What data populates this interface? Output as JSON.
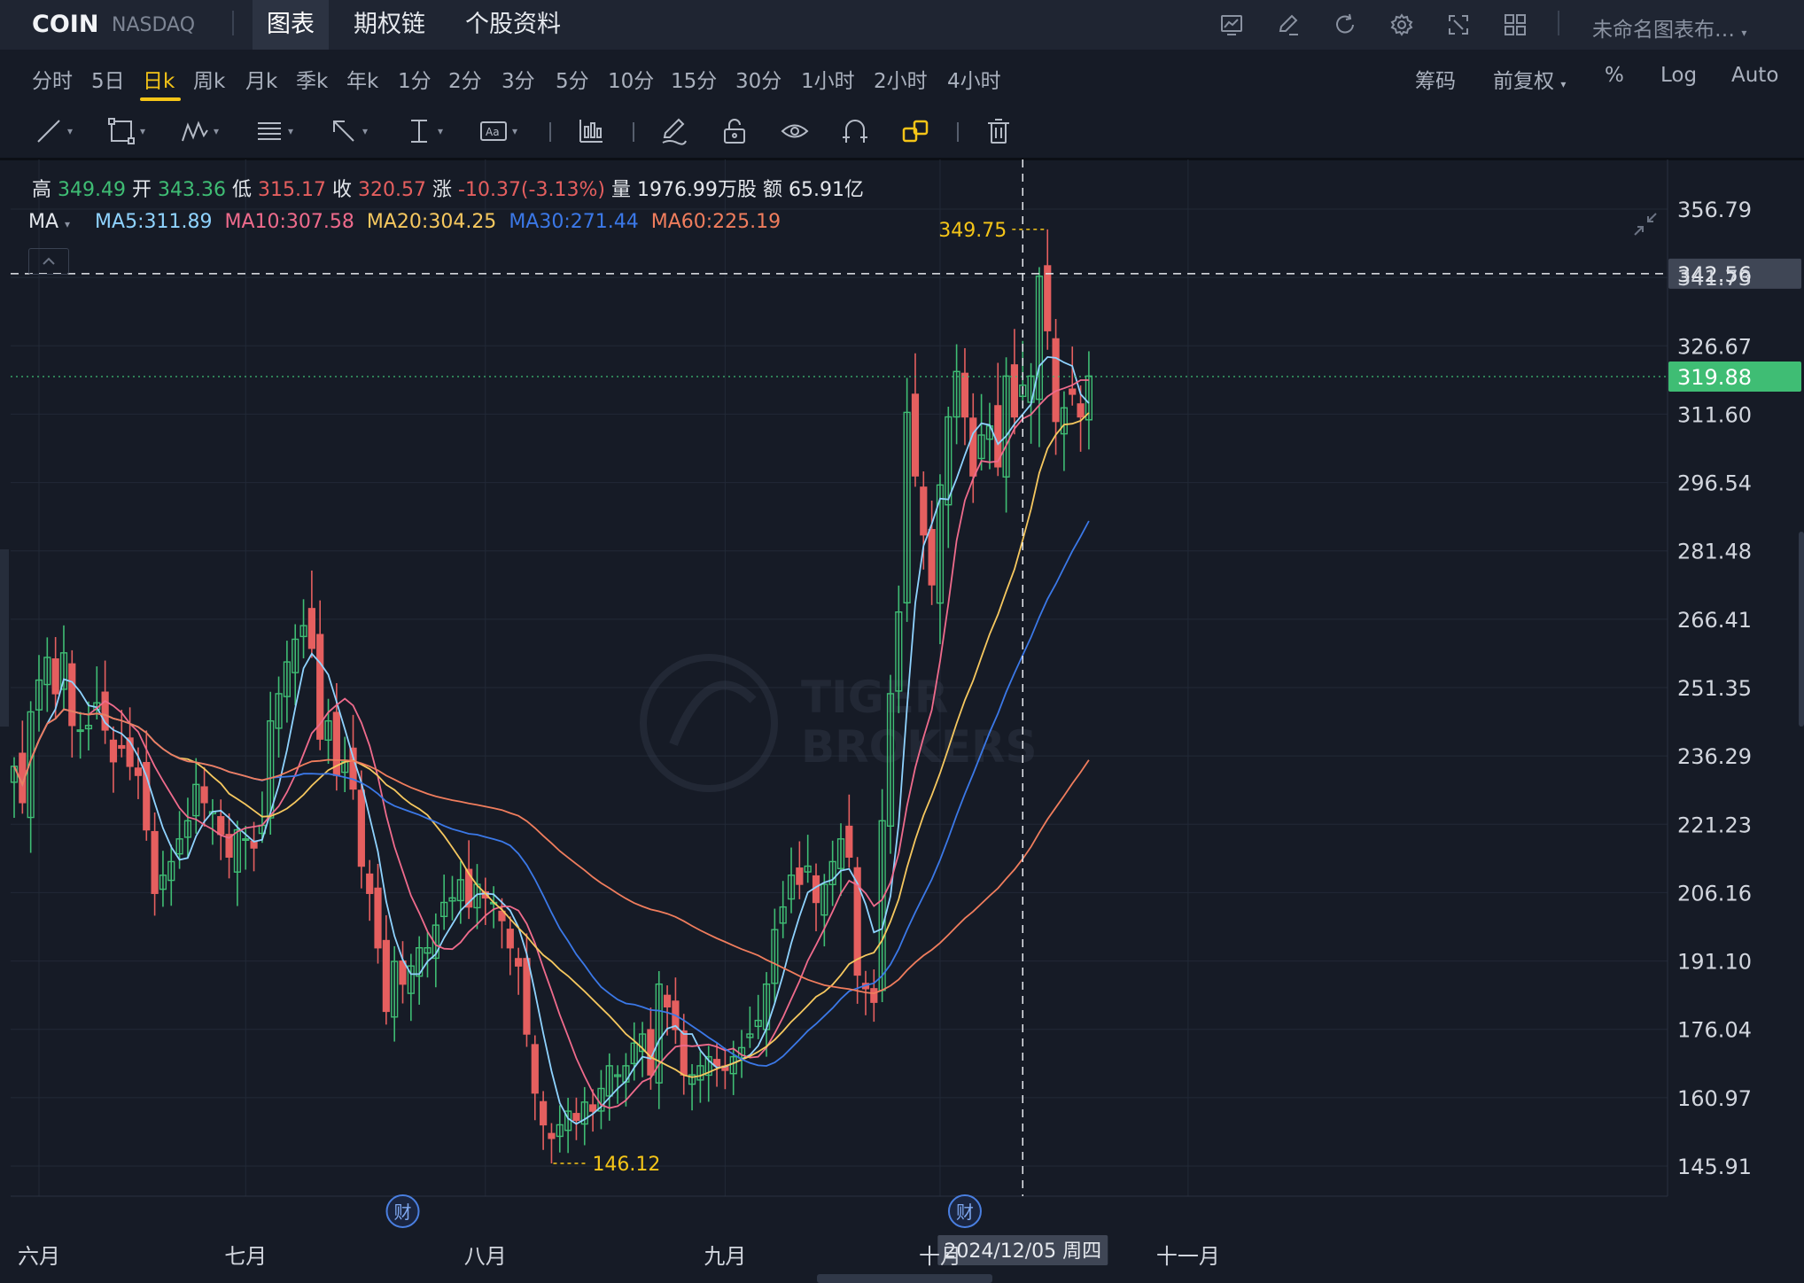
{
  "symbol": "COIN",
  "exchange": "NASDAQ",
  "top_tabs": [
    "图表",
    "期权链",
    "个股资料"
  ],
  "toolbar_icons": [
    "chart-settings-icon",
    "edit-icon",
    "refresh-icon",
    "gear-icon",
    "fullscreen-icon",
    "layout-grid-icon"
  ],
  "layout_name": "未命名图表布…",
  "periods": [
    "分时",
    "5日",
    "日k",
    "周k",
    "月k",
    "季k",
    "年k",
    "1分",
    "2分",
    "3分",
    "5分",
    "10分",
    "15分",
    "30分",
    "1小时",
    "2小时",
    "4小时"
  ],
  "active_period": "日k",
  "right_options": {
    "chips": "筹码",
    "adjust": "前复权",
    "percent": "%",
    "log": "Log",
    "auto": "Auto"
  },
  "drawing_tools": [
    "line-tool-icon",
    "rectangle-tool-icon",
    "pattern-tool-icon",
    "fib-tool-icon",
    "arrow-tool-icon",
    "measure-tool-icon",
    "text-tool-icon",
    "indicator-icon",
    "pencil-icon",
    "lock-icon",
    "eye-icon",
    "magnet-icon",
    "link-icon",
    "trash-icon"
  ],
  "ohlc": {
    "high_label": "高",
    "high": "349.49",
    "open_label": "开",
    "open": "343.36",
    "low_label": "低",
    "low": "315.17",
    "close_label": "收",
    "close": "320.57",
    "change_label": "涨",
    "change": "-10.37(-3.13%)",
    "volume_label": "量",
    "volume": "1976.99万股",
    "amount_label": "额",
    "amount": "65.91亿"
  },
  "ma": {
    "label": "MA",
    "ma5": "MA5:311.89",
    "ma10": "MA10:307.58",
    "ma20": "MA20:304.25",
    "ma30": "MA30:271.44",
    "ma60": "MA60:225.19"
  },
  "colors": {
    "up": "#3fbd74",
    "down": "#e55f5f",
    "ma5": "#8fd3ff",
    "ma10": "#ef6b8c",
    "ma20": "#f6c85f",
    "ma30": "#3b78e7",
    "ma60": "#f07d5d",
    "accent": "#f5c518"
  },
  "chart_data": {
    "type": "candlestick",
    "y_ticks": [
      356.79,
      341.73,
      326.67,
      311.6,
      296.54,
      281.48,
      266.41,
      251.35,
      236.29,
      221.23,
      206.16,
      191.1,
      176.04,
      160.97,
      145.91
    ],
    "x_ticks": [
      "六月",
      "七月",
      "八月",
      "九月",
      "十月",
      "十一月"
    ],
    "crosshair_price": "342.56",
    "crosshair_date": "2024/12/05 周四",
    "last_price": "319.88",
    "max_label": "349.75",
    "min_label": "146.12",
    "earnings_marker": "财",
    "watermark_line1": "TIGER",
    "watermark_line2": "BROKERS",
    "closes": [
      234,
      226,
      246,
      253,
      258,
      250,
      259,
      243,
      242,
      243,
      248,
      242,
      235,
      238,
      234,
      232,
      220,
      206,
      210,
      213,
      218,
      222,
      230,
      226,
      224,
      219,
      214,
      220,
      218,
      216,
      221,
      244,
      250,
      257,
      262,
      265,
      260,
      240,
      244,
      232,
      235,
      229,
      212,
      206,
      194,
      180,
      191,
      186,
      190,
      194,
      194,
      199,
      204,
      205,
      209,
      203,
      208,
      205,
      204,
      200,
      194,
      190,
      175,
      162,
      155,
      152,
      155,
      158,
      156,
      160,
      158,
      163,
      168,
      166,
      168,
      173,
      175,
      166,
      186,
      181,
      176,
      166,
      166,
      168,
      170,
      168,
      167,
      170,
      172,
      175,
      178,
      186,
      198,
      203,
      210,
      208,
      212,
      204,
      208,
      213,
      218,
      214,
      188,
      185,
      182,
      222,
      250,
      268,
      312,
      298,
      285,
      274,
      296,
      311,
      321,
      311,
      298,
      307,
      309,
      300,
      320,
      311,
      318,
      320,
      342,
      330,
      310,
      313,
      316,
      311,
      320
    ]
  }
}
